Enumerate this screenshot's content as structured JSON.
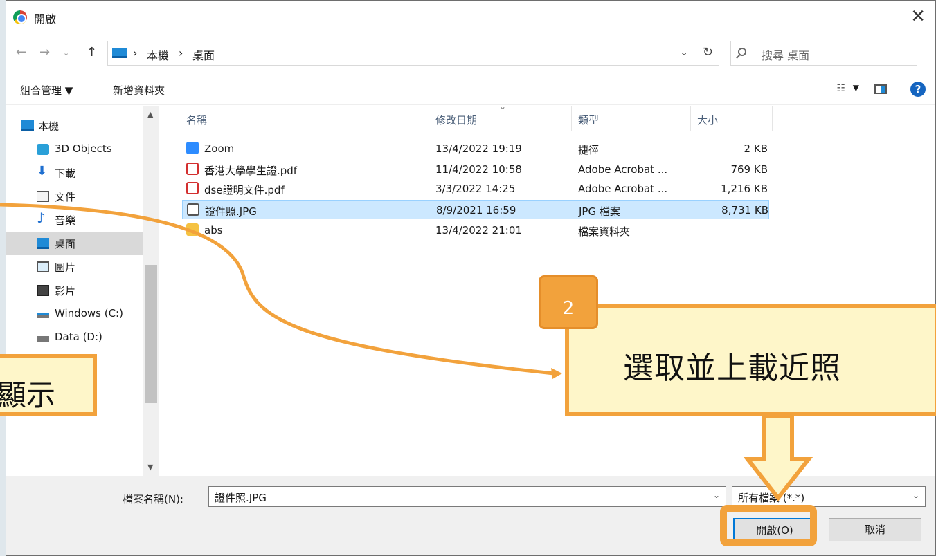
{
  "window": {
    "title": "開啟"
  },
  "address": {
    "crumbs": [
      "本機",
      "桌面"
    ],
    "separator": "›",
    "search_placeholder": "搜尋 桌面"
  },
  "toolbar": {
    "organize": "組合管理 ▼",
    "new_folder": "新增資料夾"
  },
  "nav": {
    "items": [
      {
        "label": "本機",
        "icon": "computer-icon"
      },
      {
        "label": "3D Objects",
        "icon": "cube-icon"
      },
      {
        "label": "下載",
        "icon": "download-icon"
      },
      {
        "label": "文件",
        "icon": "document-icon"
      },
      {
        "label": "音樂",
        "icon": "music-icon"
      },
      {
        "label": "桌面",
        "icon": "desktop-icon",
        "selected": true
      },
      {
        "label": "圖片",
        "icon": "picture-icon"
      },
      {
        "label": "影片",
        "icon": "video-icon"
      },
      {
        "label": "Windows (C:)",
        "icon": "drive-icon"
      },
      {
        "label": "Data (D:)",
        "icon": "drive-icon"
      }
    ]
  },
  "columns": {
    "name": "名稱",
    "date": "修改日期",
    "type": "類型",
    "size": "大小"
  },
  "files": [
    {
      "name": "Zoom",
      "date": "13/4/2022 19:19",
      "type": "捷徑",
      "size": "2 KB",
      "icon": "shortcut-icon"
    },
    {
      "name": "香港大學學生證.pdf",
      "date": "11/4/2022 10:58",
      "type": "Adobe Acrobat ...",
      "size": "769 KB",
      "icon": "pdf-icon"
    },
    {
      "name": "dse證明文件.pdf",
      "date": "3/3/2022 14:25",
      "type": "Adobe Acrobat ...",
      "size": "1,216 KB",
      "icon": "pdf-icon"
    },
    {
      "name": "證件照.JPG",
      "date": "8/9/2021 16:59",
      "type": "JPG 檔案",
      "size": "8,731 KB",
      "icon": "image-icon",
      "selected": true
    },
    {
      "name": "abs",
      "date": "13/4/2022 21:01",
      "type": "檔案資料夾",
      "size": "",
      "icon": "folder-icon"
    }
  ],
  "bottom": {
    "filename_label": "檔案名稱(N):",
    "filename_value": "證件照.JPG",
    "filetype_value": "所有檔案 (*.*)",
    "open_label": "開啟(O)",
    "cancel_label": "取消"
  },
  "annotations": {
    "step_number": "2",
    "callout_text": "選取並上載近照",
    "left_callout_text": "顯示"
  }
}
